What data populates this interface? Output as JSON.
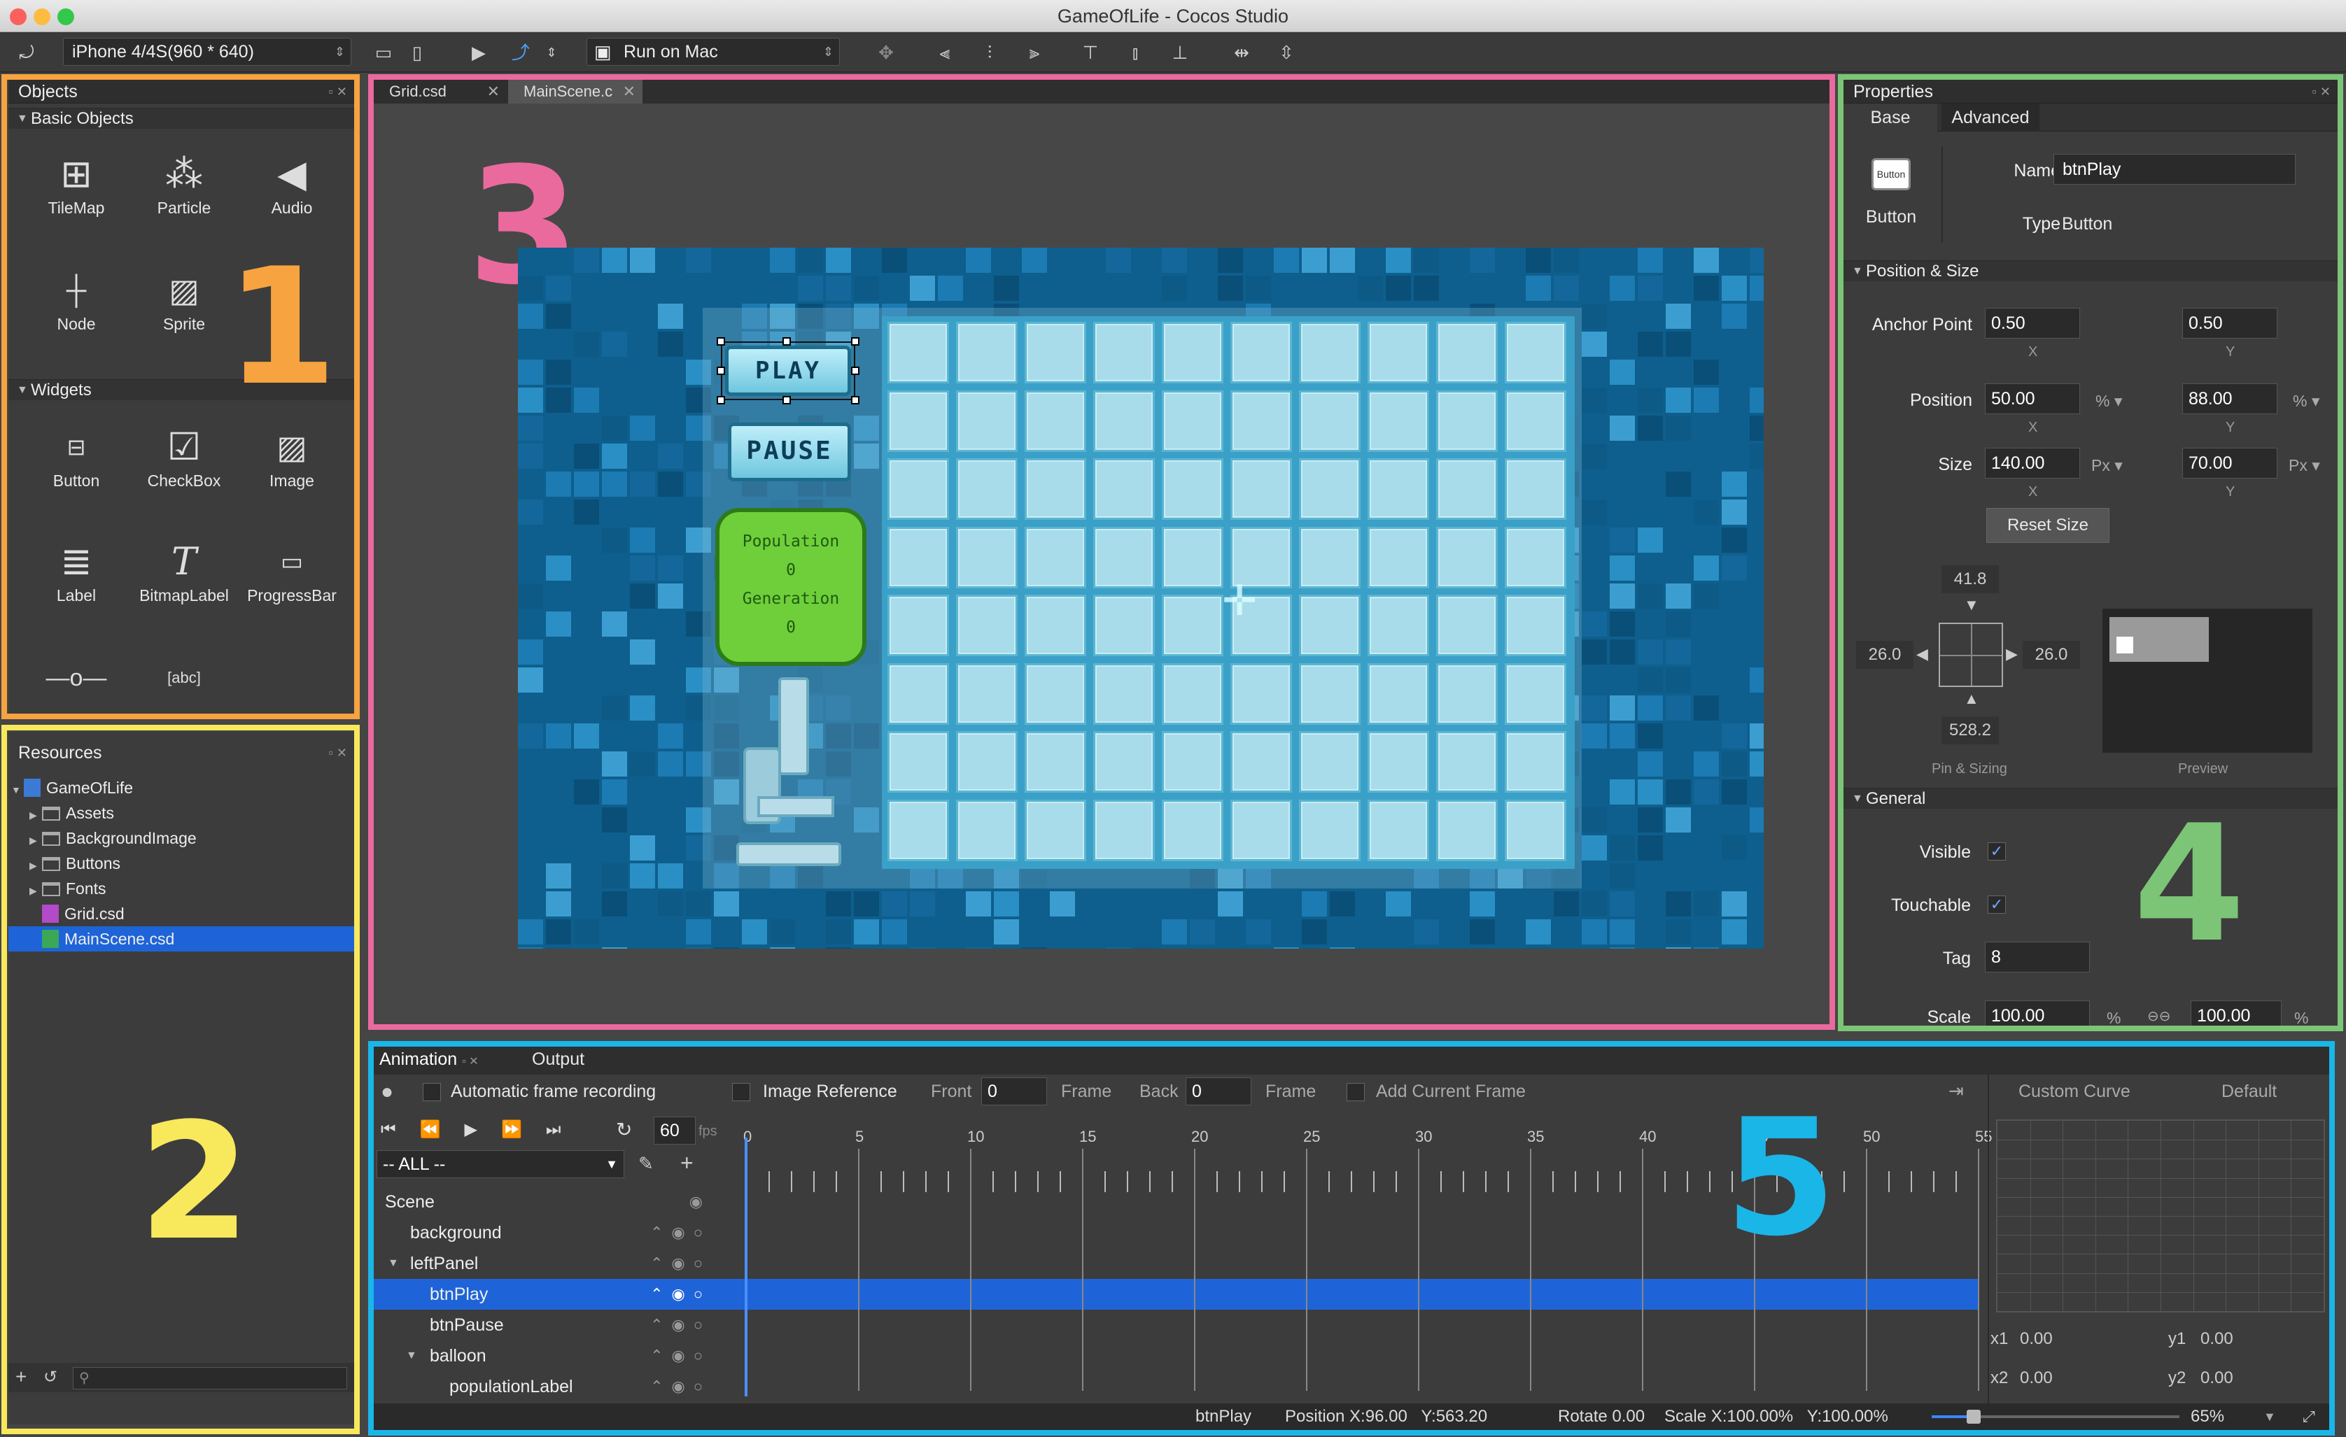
{
  "window": {
    "title": "GameOfLife - Cocos Studio"
  },
  "toolbar": {
    "device": "iPhone 4/4S(960 * 640)",
    "run_target": "Run on Mac"
  },
  "objects": {
    "title": "Objects",
    "basic_section": "Basic Objects",
    "basic": [
      {
        "label": "TileMap",
        "icon": "map-icon"
      },
      {
        "label": "Particle",
        "icon": "particle-icon"
      },
      {
        "label": "Audio",
        "icon": "speaker-icon"
      },
      {
        "label": "Node",
        "icon": "crosshair-icon"
      },
      {
        "label": "Sprite",
        "icon": "image-icon"
      }
    ],
    "widgets_section": "Widgets",
    "widgets": [
      {
        "label": "Button",
        "icon": "button-icon"
      },
      {
        "label": "CheckBox",
        "icon": "checkbox-icon"
      },
      {
        "label": "Image",
        "icon": "image-icon"
      },
      {
        "label": "Label",
        "icon": "label-icon"
      },
      {
        "label": "BitmapLabel",
        "icon": "bitmap-label-icon"
      },
      {
        "label": "ProgressBar",
        "icon": "progressbar-icon"
      }
    ],
    "annotation": "1"
  },
  "resources": {
    "title": "Resources",
    "tree": [
      {
        "label": "GameOfLife"
      },
      {
        "label": "Assets"
      },
      {
        "label": "BackgroundImage"
      },
      {
        "label": "Buttons"
      },
      {
        "label": "Fonts"
      },
      {
        "label": "Grid.csd"
      },
      {
        "label": "MainScene.csd"
      }
    ],
    "annotation": "2"
  },
  "editor": {
    "tabs": [
      "Grid.csd",
      "MainScene.c"
    ],
    "annotation": "3",
    "play_label": "PLAY",
    "pause_label": "PAUSE",
    "population_label": "Population",
    "population_value": "0",
    "generation_label": "Generation",
    "generation_value": "0"
  },
  "properties": {
    "title": "Properties",
    "tabs": [
      "Base",
      "Advanced"
    ],
    "widget_label": "Button",
    "widget_icon_text": "Button",
    "name_label": "Name",
    "name_value": "btnPlay",
    "type_label": "Type",
    "type_value": "Button",
    "pos_size_section": "Position & Size",
    "anchor_label": "Anchor Point",
    "anchor_x": "0.50",
    "anchor_y": "0.50",
    "position_label": "Position",
    "position_x": "50.00",
    "position_y": "88.00",
    "position_unit": "%",
    "size_label": "Size",
    "size_x": "140.00",
    "size_y": "70.00",
    "size_unit": "Px",
    "x_axis": "X",
    "y_axis": "Y",
    "reset_size": "Reset Size",
    "pin_top": "41.8",
    "pin_left": "26.0",
    "pin_right": "26.0",
    "pin_bottom": "528.2",
    "pin_caption": "Pin & Sizing",
    "preview_caption": "Preview",
    "general_section": "General",
    "visible_label": "Visible",
    "touchable_label": "Touchable",
    "tag_label": "Tag",
    "tag_value": "8",
    "scale_label": "Scale",
    "scale_x": "100.00",
    "scale_y": "100.00",
    "scale_unit": "%",
    "annotation": "4"
  },
  "animation": {
    "tabs": [
      "Animation",
      "Output"
    ],
    "auto_record": "Automatic frame recording",
    "image_ref": "Image Reference",
    "front_label": "Front",
    "front_value": "0",
    "frame_label": "Frame",
    "back_label": "Back",
    "back_value": "0",
    "add_frame": "Add Current Frame",
    "fps_value": "60",
    "fps_label": "fps",
    "filter": "-- ALL --",
    "custom_curve": "Custom Curve",
    "default_label": "Default",
    "ticks": [
      "0",
      "5",
      "10",
      "15",
      "20",
      "25",
      "30",
      "35",
      "40",
      "45",
      "50",
      "55"
    ],
    "tracks": [
      {
        "label": "Scene"
      },
      {
        "label": "background"
      },
      {
        "label": "leftPanel"
      },
      {
        "label": "btnPlay"
      },
      {
        "label": "btnPause"
      },
      {
        "label": "balloon"
      },
      {
        "label": "populationLabel"
      }
    ],
    "x1_label": "x1",
    "x1_value": "0.00",
    "y1_label": "y1",
    "y1_value": "0.00",
    "x2_label": "x2",
    "x2_value": "0.00",
    "y2_label": "y2",
    "y2_value": "0.00",
    "annotation": "5"
  },
  "status": {
    "node": "btnPlay",
    "position": "Position X:96.00   Y:563.20",
    "rotate": "Rotate 0.00",
    "scale": "Scale X:100.00%   Y:100.00%",
    "zoom": "65%"
  },
  "colors": {
    "objects_frame": "#f6a340",
    "resources_frame": "#f8e85c",
    "editor_frame": "#ea6a9e",
    "properties_frame": "#7cc576",
    "animation_frame": "#1ab6e8",
    "selection": "#1e64d8"
  }
}
